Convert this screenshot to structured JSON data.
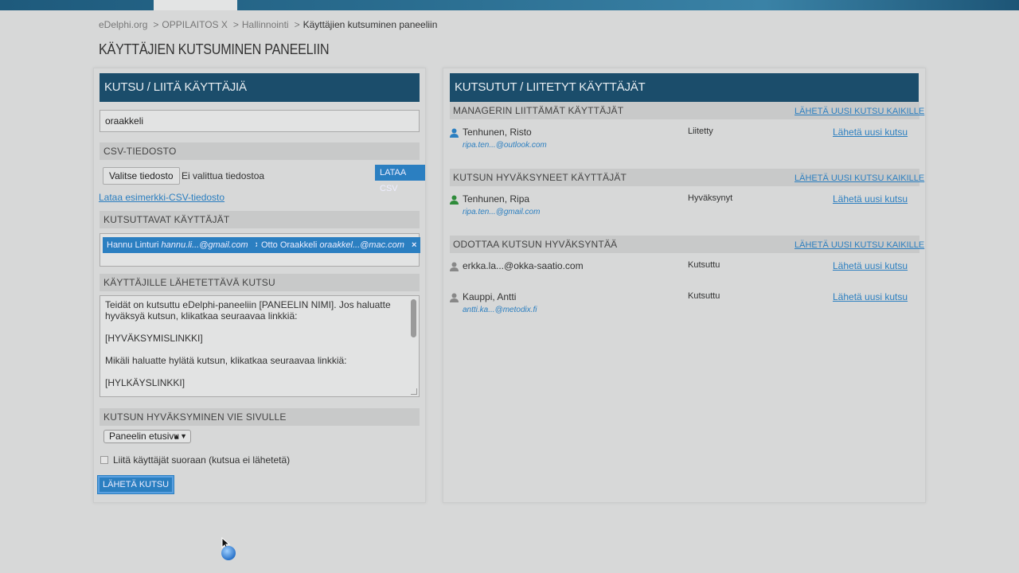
{
  "breadcrumb": {
    "items": [
      "eDelphi.org",
      "OPPILAITOS X",
      "Hallinnointi"
    ],
    "separator": ">",
    "current": "Käyttäjien kutsuminen paneeliin"
  },
  "page_title": "KÄYTTÄJIEN KUTSUMINEN PANEELIIN",
  "left": {
    "header": "KUTSU / LIITÄ KÄYTTÄJIÄ",
    "search_value": "oraakkeli",
    "csv_section": "CSV-TIEDOSTO",
    "choose_file": "Valitse tiedosto",
    "no_file": "Ei valittua tiedostoa",
    "upload_csv": "LATAA CSV",
    "example_link": "Lataa esimerkki-CSV-tiedosto",
    "invited_section": "KUTSUTTAVAT KÄYTTÄJÄT",
    "tags": [
      {
        "name": "Hannu Linturi",
        "email": "hannu.li...@gmail.com",
        "remove": "×"
      },
      {
        "name": "Otto Oraakkeli",
        "email": "oraakkel...@mac.com",
        "remove": "×"
      }
    ],
    "message_section": "KÄYTTÄJILLE LÄHETETTÄVÄ KUTSU",
    "message_lines": [
      "Teidät on kutsuttu eDelphi-paneeliin [PANEELIN NIMI]. Jos haluatte hyväksyä kutsun, klikatkaa seuraavaa linkkiä:",
      "[HYVÄKSYMISLINKKI]",
      "Mikäli haluatte hylätä kutsun, klikatkaa seuraavaa linkkiä:",
      "[HYLKÄYSLINKKI]"
    ],
    "redirect_section": "KUTSUN HYVÄKSYMINEN VIE SIVULLE",
    "redirect_select": "Paneelin etusivu",
    "direct_add_label": "Liitä käyttäjät suoraan (kutsua ei lähetetä)",
    "send_button": "LÄHETÄ KUTSU"
  },
  "right": {
    "header": "KUTSUTUT / LIITETYT KÄYTTÄJÄT",
    "resend_all": "LÄHETÄ UUSI KUTSU KAIKILLE",
    "resend": "Lähetä uusi kutsu",
    "groups": [
      {
        "title": "MANAGERIN LIITTÄMÄT KÄYTTÄJÄT",
        "users": [
          {
            "name": "Tenhunen, Risto",
            "email": "ripa.ten...@outlook.com",
            "status": "Liitetty",
            "icon_color": "#2b7fc1"
          }
        ]
      },
      {
        "title": "KUTSUN HYVÄKSYNEET KÄYTTÄJÄT",
        "users": [
          {
            "name": "Tenhunen, Ripa",
            "email": "ripa.ten...@gmail.com",
            "status": "Hyväksynyt",
            "icon_color": "#2e8b3a"
          }
        ]
      },
      {
        "title": "ODOTTAA KUTSUN HYVÄKSYNTÄÄ",
        "users": [
          {
            "name": "erkka.la...@okka-saatio.com",
            "email": "",
            "status": "Kutsuttu",
            "icon_color": "#888888"
          },
          {
            "name": "Kauppi, Antti",
            "email": "antti.ka...@metodix.fi",
            "status": "Kutsuttu",
            "icon_color": "#888888"
          }
        ]
      }
    ]
  },
  "colors": {
    "header_bg": "#1b4d6b",
    "accent": "#2b7fc1",
    "link": "#2c7fc0"
  }
}
